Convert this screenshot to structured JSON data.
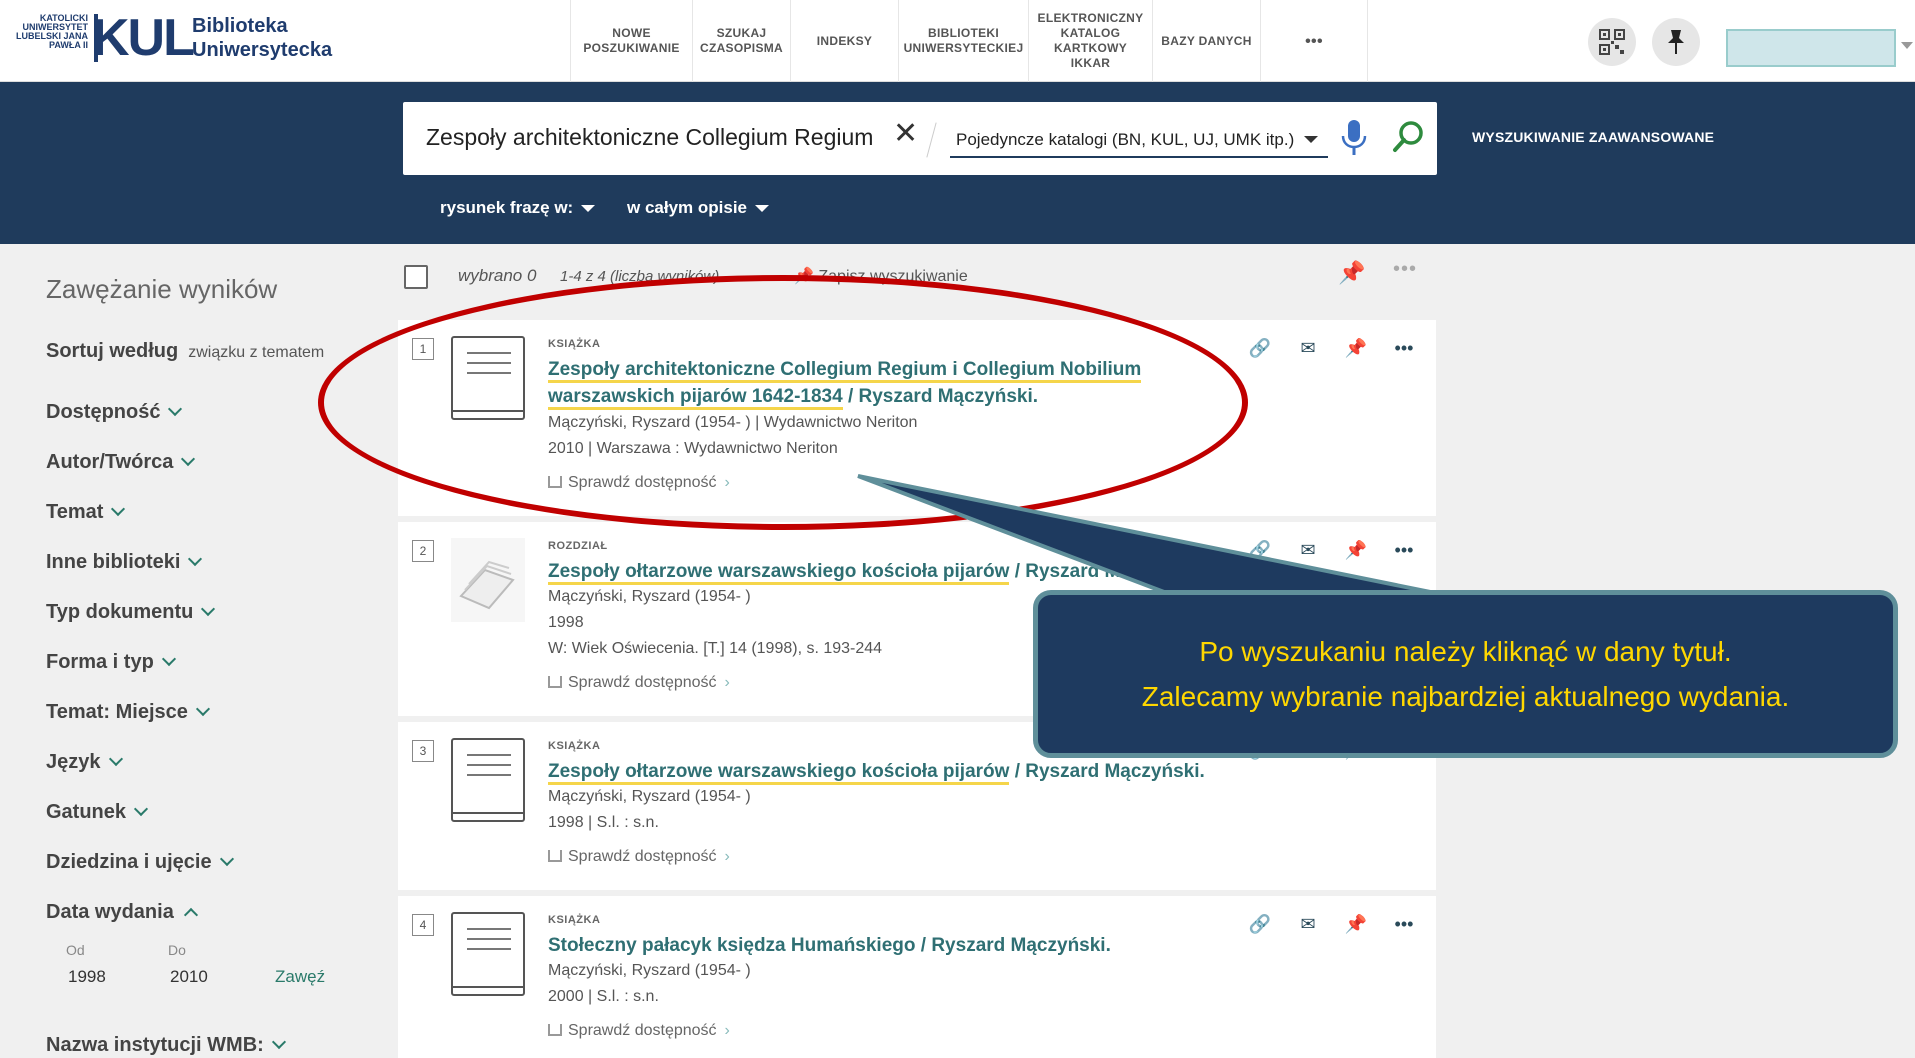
{
  "header": {
    "logo_small": "KATOLICKI UNIWERSYTET LUBELSKI JANA PAWŁA II",
    "logo_kul": "KUL",
    "logo_name_1": "Biblioteka",
    "logo_name_2": "Uniwersytecka",
    "nav": [
      {
        "label": "NOWE POSZUKIWANIE"
      },
      {
        "label": "SZUKAJ CZASOPISMA"
      },
      {
        "label": "INDEKSY"
      },
      {
        "label": "BIBLIOTEKI UNIWERSYTECKIEJ"
      },
      {
        "label": "ELEKTRONICZNY KATALOG KARTKOWY IKKAR"
      },
      {
        "label": "BAZY DANYCH"
      },
      {
        "label": "•••"
      }
    ]
  },
  "search": {
    "query": "Zespoły architektoniczne Collegium Regium i Collegium Nobilium",
    "scope": "Pojedyncze katalogi (BN, KUL, UJ, UMK itp.)",
    "advanced": "WYSZUKIWANIE ZAAWANSOWANE",
    "filter_type": "rysunek frazę w:",
    "filter_field": "w całym opisie"
  },
  "sidebar": {
    "title": "Zawężanie wyników",
    "sort_label": "Sortuj według",
    "sort_value": "związku z tematem",
    "facets": [
      "Dostępność",
      "Autor/Twórca",
      "Temat",
      "Inne biblioteki",
      "Typ dokumentu",
      "Forma i typ",
      "Temat: Miejsce",
      "Język",
      "Gatunek",
      "Dziedzina i ujęcie",
      "Data wydania"
    ],
    "date_from_label": "Od",
    "date_to_label": "Do",
    "date_from": "1998",
    "date_to": "2010",
    "apply": "Zawęź",
    "last_facet": "Nazwa instytucji WMB:"
  },
  "results_head": {
    "selected": "wybrano 0",
    "count": "1-4 z 4 (liczba wyników)",
    "save": "Zapisz wyszukiwanie"
  },
  "results": [
    {
      "num": "1",
      "type": "KSIĄŻKA",
      "title": "Zespoły architektoniczne Collegium Regium i Collegium Nobilium warszawskich pijarów 1642-1834",
      "author_suffix": " / Ryszard Mączyński.",
      "line1": "Mączyński, Ryszard (1954- ) | Wydawnictwo Neriton",
      "line2": "2010 | Warszawa : Wydawnictwo Neriton",
      "line3": "",
      "avail": "Sprawdź dostępność"
    },
    {
      "num": "2",
      "type": "ROZDZIAŁ",
      "title": "Zespoły ołtarzowe warszawskiego kościoła pijarów",
      "author_suffix": " / Ryszard M",
      "line1": "Mączyński, Ryszard (1954- )",
      "line2": "1998",
      "line3": "W: Wiek Oświecenia. [T.] 14 (1998), s. 193-244",
      "avail": "Sprawdź dostępność"
    },
    {
      "num": "3",
      "type": "KSIĄŻKA",
      "title": "Zespoły ołtarzowe warszawskiego kościoła pijarów",
      "author_suffix": " / Ryszard Mączyński.",
      "line1": "Mączyński, Ryszard (1954- )",
      "line2": "1998 | S.l. : s.n.",
      "line3": "",
      "avail": "Sprawdź dostępność"
    },
    {
      "num": "4",
      "type": "KSIĄŻKA",
      "title": "Stołeczny pałacyk księdza Humańskiego",
      "author_suffix": " / Ryszard Mączyński.",
      "line1": "Mączyński, Ryszard (1954- )",
      "line2": "2000 | S.l. : s.n.",
      "line3": "",
      "avail": "Sprawdź dostępność"
    }
  ],
  "callout": {
    "line1": "Po wyszukaniu należy kliknąć w dany tytuł.",
    "line2": "Zalecamy wybranie najbardziej aktualnego wydania."
  },
  "icons": {
    "qr": "qr-code-icon",
    "pin": "pin-icon",
    "link": "link-icon",
    "mail": "mail-icon",
    "more": "more-icon",
    "mic": "microphone-icon",
    "search": "search-icon",
    "book": "book-icon"
  },
  "colors": {
    "navy": "#1f3b5c",
    "teal_link": "#2f6f73",
    "highlight": "#f5d54a",
    "annotation_red": "#c00000",
    "callout_text": "#ffd700"
  }
}
